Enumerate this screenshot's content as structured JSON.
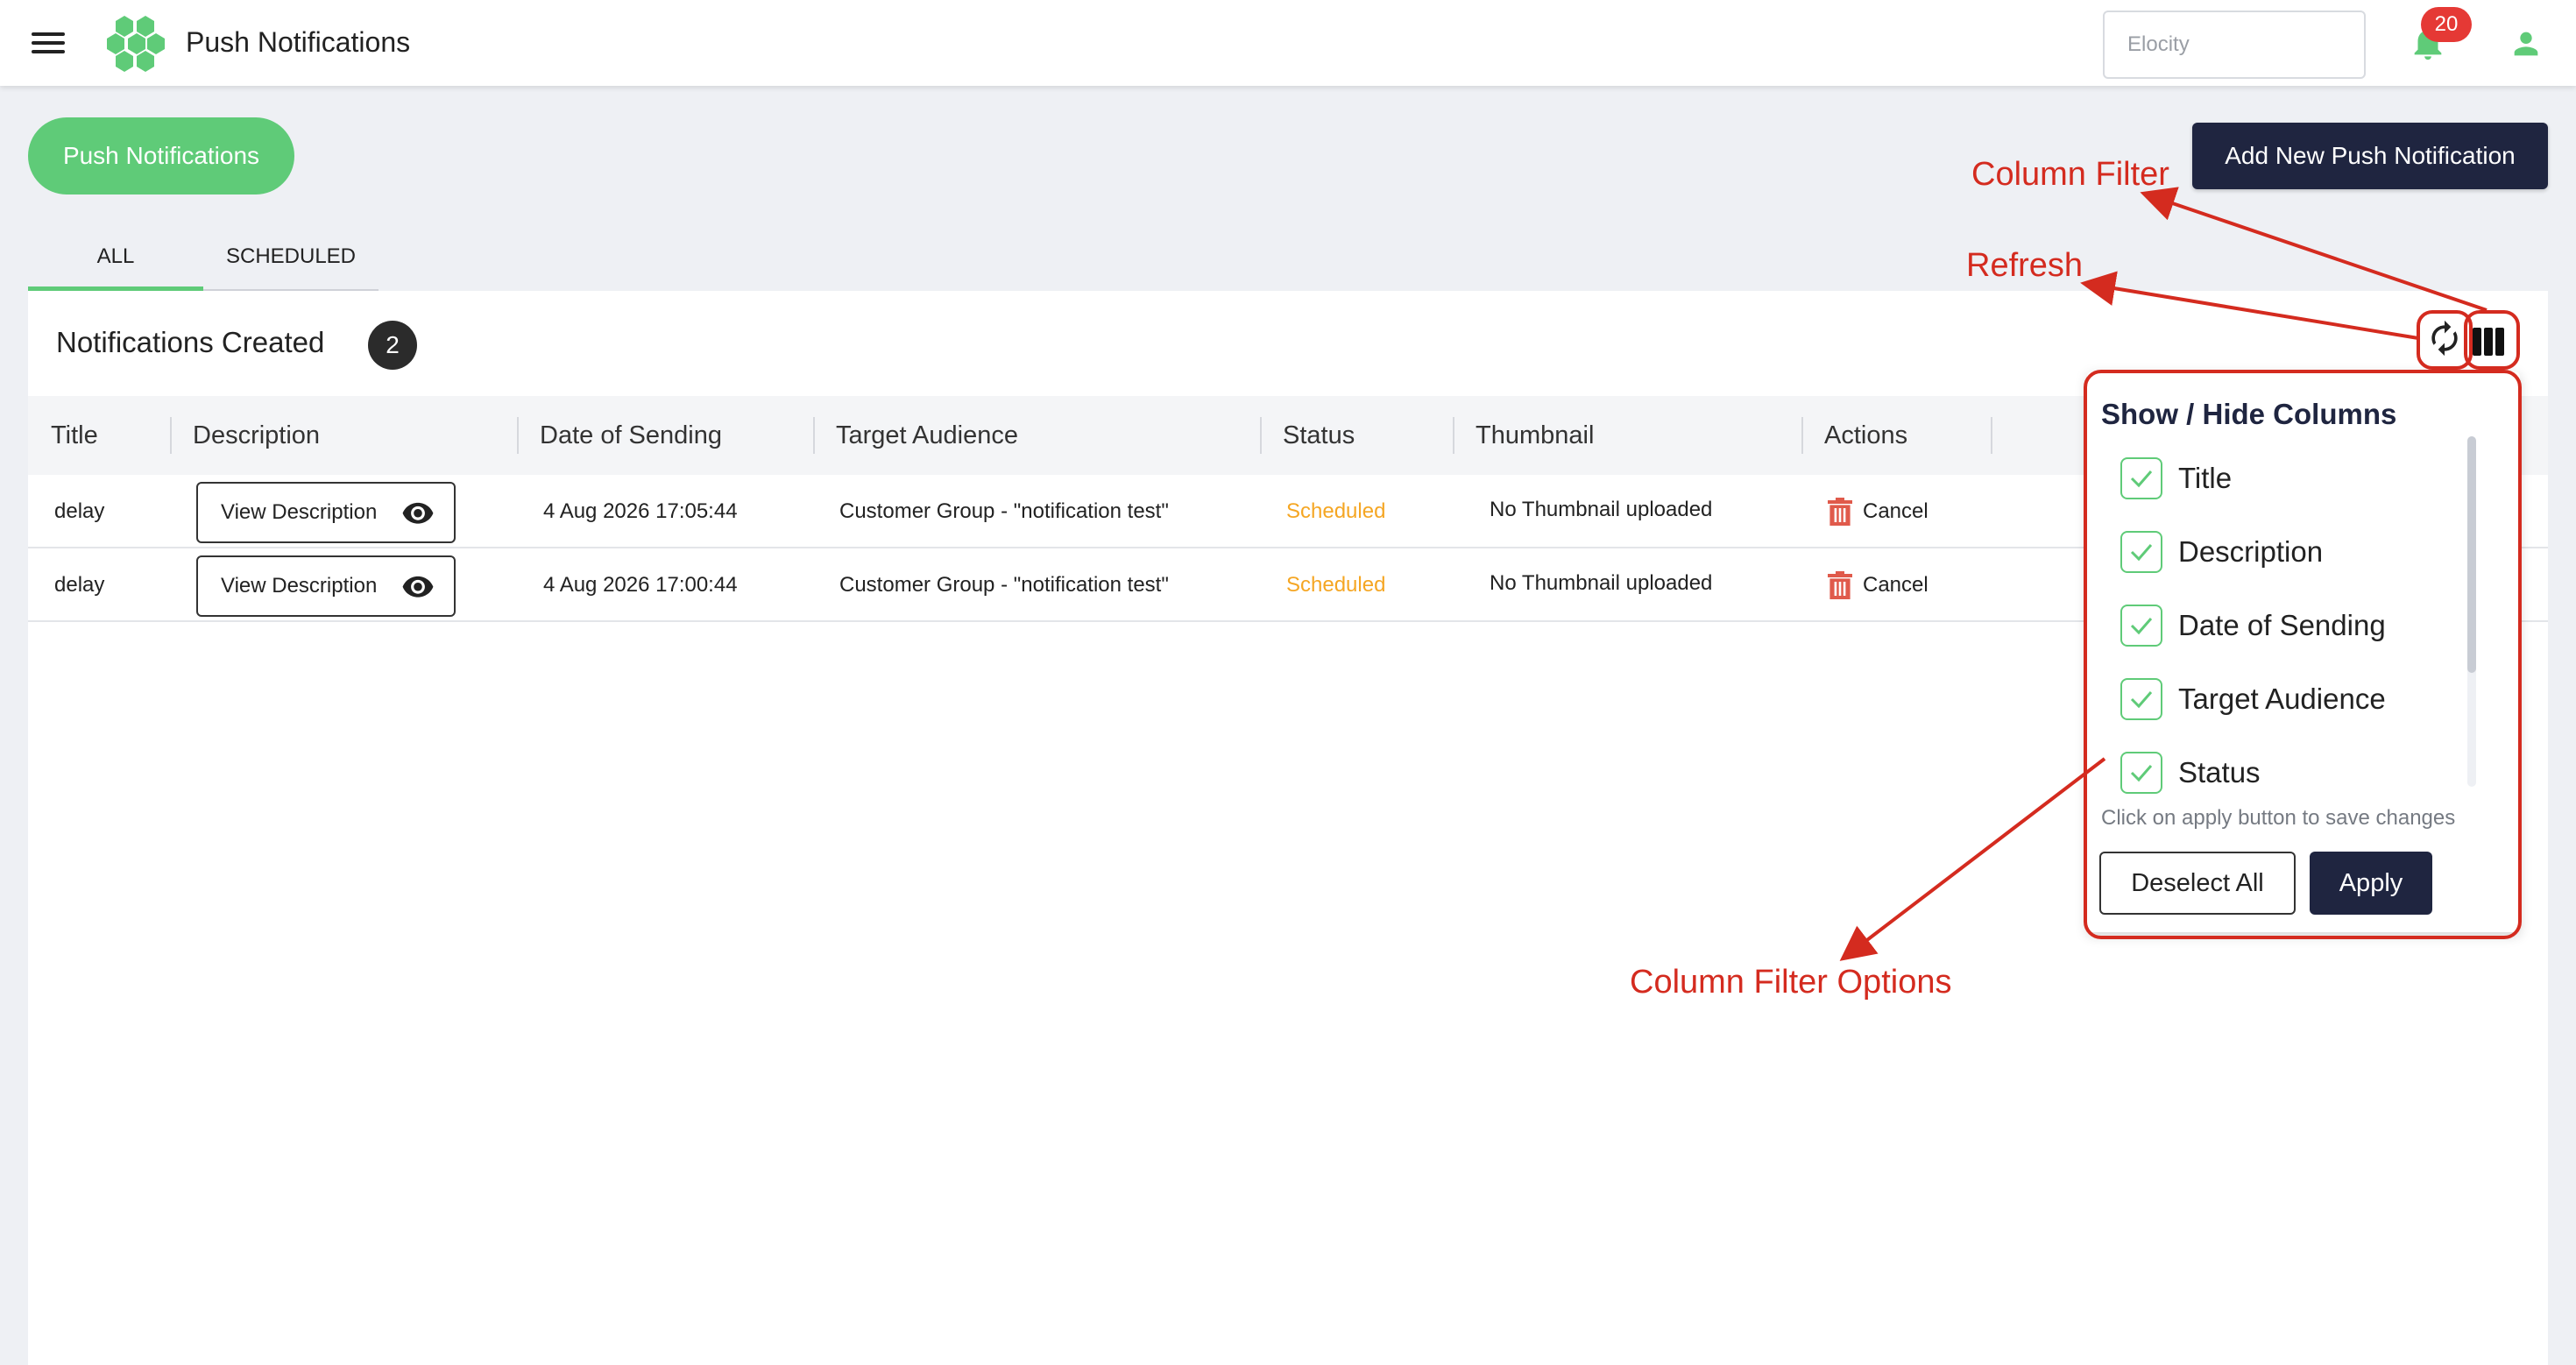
{
  "topbar": {
    "app_title": "Push Notifications",
    "search_placeholder": "Elocity",
    "notification_count": "20"
  },
  "header": {
    "section_pill": "Push Notifications",
    "add_button": "Add New Push Notification"
  },
  "tabs": [
    {
      "label": "ALL",
      "active": true
    },
    {
      "label": "SCHEDULED",
      "active": false
    }
  ],
  "table": {
    "title": "Notifications Created",
    "count": "2",
    "columns": [
      "Title",
      "Description",
      "Date of Sending",
      "Target Audience",
      "Status",
      "Thumbnail",
      "Actions"
    ],
    "rows": [
      {
        "title": "delay",
        "description_button": "View Description",
        "date": "4 Aug 2026 17:05:44",
        "audience": "Customer Group - \"notification test\"",
        "status": "Scheduled",
        "thumbnail": "No Thumbnail uploaded",
        "action": "Cancel"
      },
      {
        "title": "delay",
        "description_button": "View Description",
        "date": "4 Aug 2026 17:00:44",
        "audience": "Customer Group - \"notification test\"",
        "status": "Scheduled",
        "thumbnail": "No Thumbnail uploaded",
        "action": "Cancel"
      }
    ]
  },
  "column_filter": {
    "title": "Show / Hide Columns",
    "options": [
      {
        "label": "Title",
        "checked": true
      },
      {
        "label": "Description",
        "checked": true
      },
      {
        "label": "Date of Sending",
        "checked": true
      },
      {
        "label": "Target Audience",
        "checked": true
      },
      {
        "label": "Status",
        "checked": true
      }
    ],
    "hint": "Click on apply button to save changes",
    "deselect_button": "Deselect All",
    "apply_button": "Apply"
  },
  "annotations": {
    "column_filter": "Column Filter",
    "refresh": "Refresh",
    "column_filter_options": "Column Filter Options"
  },
  "colors": {
    "brand_green": "#5fcb78",
    "navy": "#1f2540",
    "status_scheduled": "#f5a623",
    "annotation_red": "#d42b1f",
    "badge_red": "#e53935"
  },
  "icons": [
    "menu-icon",
    "logo-icon",
    "bell-icon",
    "user-icon",
    "eye-icon",
    "trash-icon",
    "refresh-icon",
    "columns-icon",
    "check-icon"
  ]
}
